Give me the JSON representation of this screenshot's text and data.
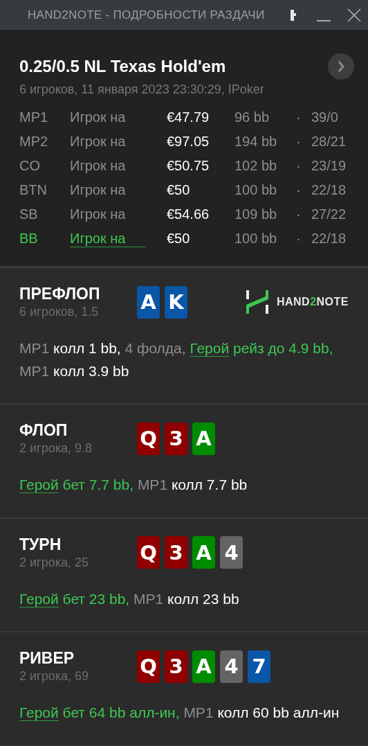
{
  "window": {
    "title": "HAND2NOTE - ПОДРОБНОСТИ РАЗДАЧИ"
  },
  "hand": {
    "title": "0.25/0.5 NL Texas Hold'em",
    "subtitle": "6 игроков, 11 января 2023 23:30:29, IPoker"
  },
  "players": [
    {
      "position": "MP1",
      "name": "Игрок на",
      "stack": "€47.79",
      "bb": "96 bb",
      "separator": "·",
      "stats": "39/0",
      "hero": false
    },
    {
      "position": "MP2",
      "name": "Игрок на",
      "stack": "€97.05",
      "bb": "194 bb",
      "separator": "·",
      "stats": "28/21",
      "hero": false
    },
    {
      "position": "CO",
      "name": "Игрок на",
      "stack": "€50.75",
      "bb": "102 bb",
      "separator": "·",
      "stats": "23/19",
      "hero": false
    },
    {
      "position": "BTN",
      "name": "Игрок на",
      "stack": "€50",
      "bb": "100 bb",
      "separator": "·",
      "stats": "22/18",
      "hero": false
    },
    {
      "position": "SB",
      "name": "Игрок на",
      "stack": "€54.66",
      "bb": "109 bb",
      "separator": "·",
      "stats": "27/22",
      "hero": false
    },
    {
      "position": "BB",
      "name": "Игрок на",
      "stack": "€50",
      "bb": "100 bb",
      "separator": "·",
      "stats": "22/18",
      "hero": true
    }
  ],
  "logo": [
    "HAND",
    "2",
    "NOTE"
  ],
  "streets": [
    {
      "name": "ПРЕФЛОП",
      "info": "6 игроков, 1.5",
      "logo": true,
      "cards": [
        {
          "rank": "A",
          "color": "#0a56a8"
        },
        {
          "rank": "K",
          "color": "#0a56a8"
        }
      ],
      "actions": [
        {
          "kind": "pos",
          "text": "MP1 "
        },
        {
          "kind": "act",
          "text": "колл 1 bb, "
        },
        {
          "kind": "pos",
          "text": "4 фолда, "
        },
        {
          "kind": "hero",
          "text": "Герой"
        },
        {
          "kind": "hero-act",
          "text": " рейз до 4.9 bb, "
        },
        {
          "kind": "pos",
          "text": "MP1 "
        },
        {
          "kind": "act",
          "text": "колл 3.9 bb"
        }
      ]
    },
    {
      "name": "ФЛОП",
      "info": "2 игрока, 9.8",
      "logo": false,
      "cards": [
        {
          "rank": "Q",
          "color": "#900000"
        },
        {
          "rank": "3",
          "color": "#900000"
        },
        {
          "rank": "A",
          "color": "#008c00"
        }
      ],
      "actions": [
        {
          "kind": "hero",
          "text": "Герой"
        },
        {
          "kind": "hero-act",
          "text": " бет 7.7 bb, "
        },
        {
          "kind": "pos",
          "text": "MP1 "
        },
        {
          "kind": "act",
          "text": "колл 7.7 bb"
        }
      ]
    },
    {
      "name": "ТУРН",
      "info": "2 игрока, 25",
      "logo": false,
      "cards": [
        {
          "rank": "Q",
          "color": "#900000"
        },
        {
          "rank": "3",
          "color": "#900000"
        },
        {
          "rank": "A",
          "color": "#008c00"
        },
        {
          "rank": "4",
          "color": "#646464"
        }
      ],
      "actions": [
        {
          "kind": "hero",
          "text": "Герой"
        },
        {
          "kind": "hero-act",
          "text": " бет 23 bb, "
        },
        {
          "kind": "pos",
          "text": "MP1 "
        },
        {
          "kind": "act",
          "text": "колл 23 bb"
        }
      ]
    },
    {
      "name": "РИВЕР",
      "info": "2 игрока, 69",
      "logo": false,
      "cards": [
        {
          "rank": "Q",
          "color": "#900000"
        },
        {
          "rank": "3",
          "color": "#900000"
        },
        {
          "rank": "A",
          "color": "#008c00"
        },
        {
          "rank": "4",
          "color": "#646464"
        },
        {
          "rank": "7",
          "color": "#0a56a8"
        }
      ],
      "actions": [
        {
          "kind": "hero",
          "text": "Герой"
        },
        {
          "kind": "hero-act",
          "text": " бет 64 bb алл-ин, "
        },
        {
          "kind": "pos",
          "text": "MP1 "
        },
        {
          "kind": "act",
          "text": "колл 60 bb алл-ин"
        }
      ]
    }
  ]
}
